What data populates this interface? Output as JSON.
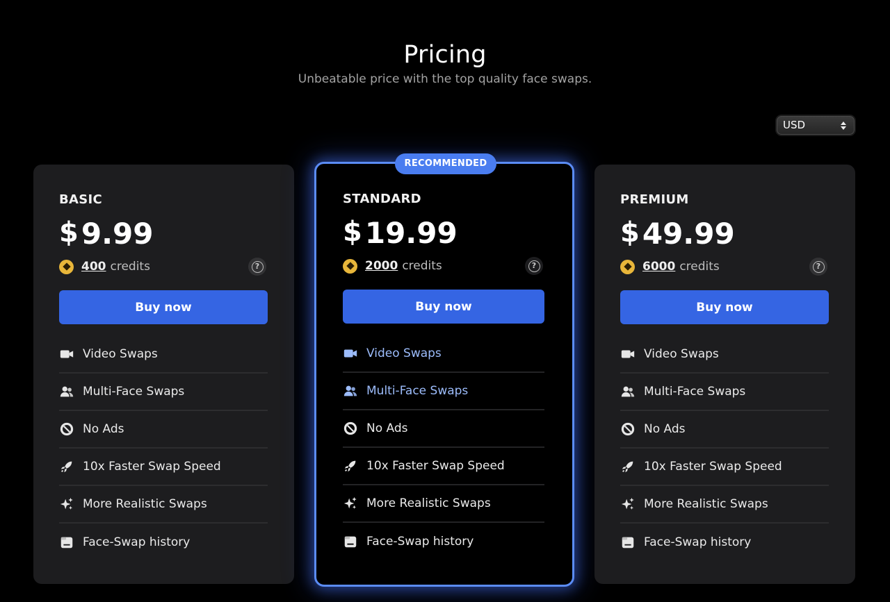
{
  "header": {
    "title": "Pricing",
    "subtitle": "Unbeatable price with the top quality face swaps."
  },
  "currency": {
    "selected": "USD"
  },
  "colors": {
    "accent": "#3565e3",
    "highlight": "#5b8cf5",
    "coin": "#e8b63a",
    "highlight_text": "#9cbcfb"
  },
  "plans": [
    {
      "name": "BASIC",
      "currency_symbol": "$",
      "price": "9.99",
      "credits": "400",
      "credits_label": "credits",
      "button": "Buy now",
      "features": [
        "Video Swaps",
        "Multi-Face Swaps",
        "No Ads",
        "10x Faster Swap Speed",
        "More Realistic Swaps",
        "Face-Swap history"
      ]
    },
    {
      "name": "STANDARD",
      "badge": "RECOMMENDED",
      "currency_symbol": "$",
      "price": "19.99",
      "credits": "2000",
      "credits_label": "credits",
      "button": "Buy now",
      "features": [
        "Video Swaps",
        "Multi-Face Swaps",
        "No Ads",
        "10x Faster Swap Speed",
        "More Realistic Swaps",
        "Face-Swap history"
      ]
    },
    {
      "name": "PREMIUM",
      "currency_symbol": "$",
      "price": "49.99",
      "credits": "6000",
      "credits_label": "credits",
      "button": "Buy now",
      "features": [
        "Video Swaps",
        "Multi-Face Swaps",
        "No Ads",
        "10x Faster Swap Speed",
        "More Realistic Swaps",
        "Face-Swap history"
      ]
    }
  ],
  "feature_icons": [
    "video-camera-icon",
    "users-icon",
    "no-ads-icon",
    "rocket-icon",
    "sparkles-icon",
    "history-folder-icon"
  ]
}
